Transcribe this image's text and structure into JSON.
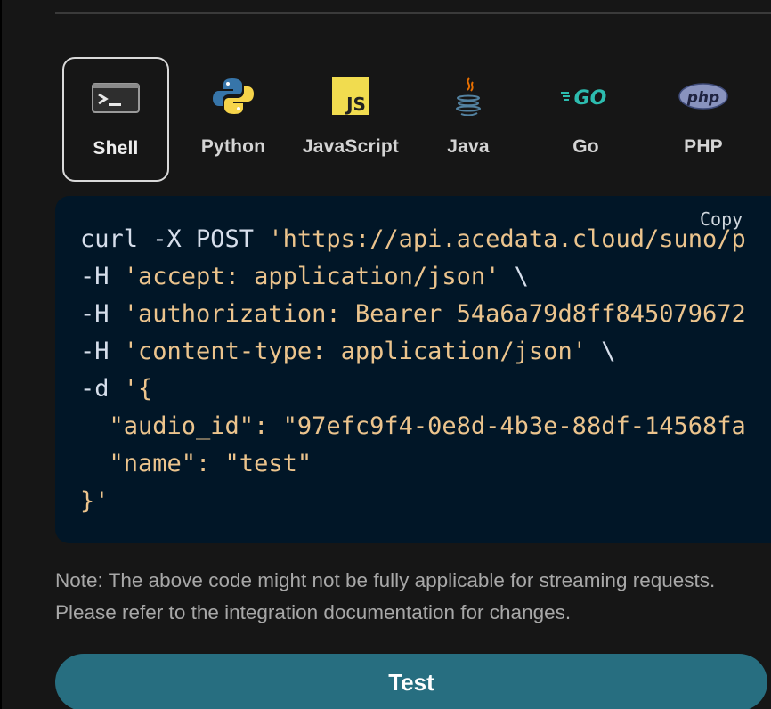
{
  "languages": {
    "tabs": [
      {
        "label": "Shell",
        "icon": "terminal-icon",
        "active": true
      },
      {
        "label": "Python",
        "icon": "python-icon",
        "active": false
      },
      {
        "label": "JavaScript",
        "icon": "javascript-icon",
        "active": false
      },
      {
        "label": "Java",
        "icon": "java-icon",
        "active": false
      },
      {
        "label": "Go",
        "icon": "go-icon",
        "active": false
      },
      {
        "label": "PHP",
        "icon": "php-icon",
        "active": false
      }
    ]
  },
  "code": {
    "copy_label": "Copy",
    "lines": [
      [
        {
          "t": "curl -X POST ",
          "c": "plain"
        },
        {
          "t": "'https://api.acedata.cloud/suno/p",
          "c": "string"
        }
      ],
      [
        {
          "t": "-H ",
          "c": "plain"
        },
        {
          "t": "'accept: application/json'",
          "c": "string"
        },
        {
          "t": " \\",
          "c": "plain"
        }
      ],
      [
        {
          "t": "-H ",
          "c": "plain"
        },
        {
          "t": "'authorization: Bearer 54a6a79d8ff845079672",
          "c": "string"
        }
      ],
      [
        {
          "t": "-H ",
          "c": "plain"
        },
        {
          "t": "'content-type: application/json'",
          "c": "string"
        },
        {
          "t": " \\",
          "c": "plain"
        }
      ],
      [
        {
          "t": "-d ",
          "c": "plain"
        },
        {
          "t": "'{",
          "c": "string"
        }
      ],
      [
        {
          "t": "  \"audio_id\": \"97efc9f4-0e8d-4b3e-88df-14568fa",
          "c": "string"
        }
      ],
      [
        {
          "t": "  \"name\": \"test\"",
          "c": "string"
        }
      ],
      [
        {
          "t": "}'",
          "c": "string"
        }
      ]
    ]
  },
  "note": "Note: The above code might not be fully applicable for streaming requests. Please refer to the integration documentation for changes.",
  "test_button_label": "Test",
  "colors": {
    "panel_bg": "#161616",
    "code_bg": "#011627",
    "code_string": "#ecc48d",
    "code_plain": "#d6deeb",
    "button_bg": "#276e80"
  }
}
